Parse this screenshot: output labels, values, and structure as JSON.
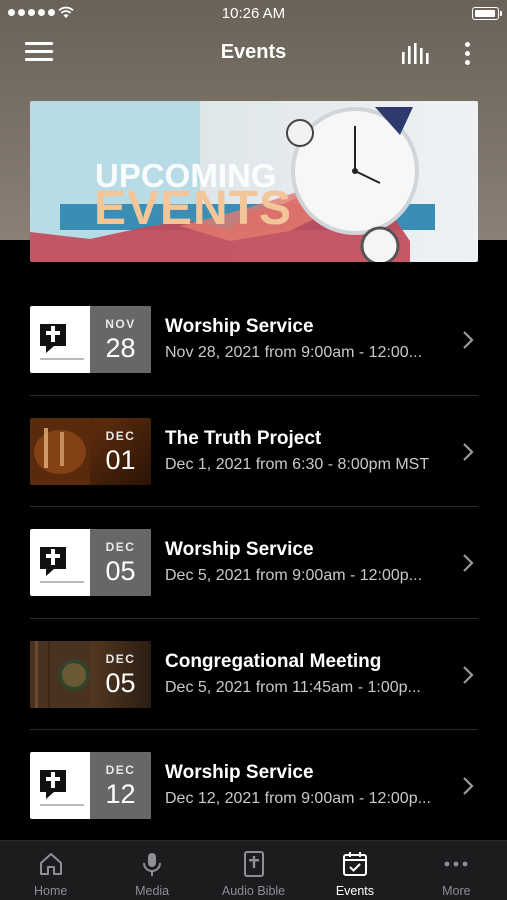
{
  "status_bar": {
    "time": "10:26 AM"
  },
  "header": {
    "title": "Events"
  },
  "banner": {
    "line1": "UPCOMING",
    "line2": "EVENTS"
  },
  "events": [
    {
      "month": "NOV",
      "day": "28",
      "title": "Worship Service",
      "subtitle": "Nov 28, 2021 from 9:00am - 12:00...",
      "thumb": "logo"
    },
    {
      "month": "DEC",
      "day": "01",
      "title": "The Truth Project",
      "subtitle": "Dec 1, 2021 from 6:30 - 8:00pm MST",
      "thumb": "truth"
    },
    {
      "month": "DEC",
      "day": "05",
      "title": "Worship Service",
      "subtitle": "Dec 5, 2021 from 9:00am - 12:00p...",
      "thumb": "logo"
    },
    {
      "month": "DEC",
      "day": "05",
      "title": "Congregational Meeting",
      "subtitle": "Dec 5, 2021 from 11:45am - 1:00p...",
      "thumb": "cong"
    },
    {
      "month": "DEC",
      "day": "12",
      "title": "Worship Service",
      "subtitle": "Dec 12, 2021 from 9:00am - 12:00p...",
      "thumb": "logo"
    }
  ],
  "tabs": [
    {
      "label": "Home",
      "icon": "home-icon",
      "active": false
    },
    {
      "label": "Media",
      "icon": "microphone-icon",
      "active": false
    },
    {
      "label": "Audio Bible",
      "icon": "bible-icon",
      "active": false
    },
    {
      "label": "Events",
      "icon": "calendar-icon",
      "active": true
    },
    {
      "label": "More",
      "icon": "more-icon",
      "active": false
    }
  ]
}
